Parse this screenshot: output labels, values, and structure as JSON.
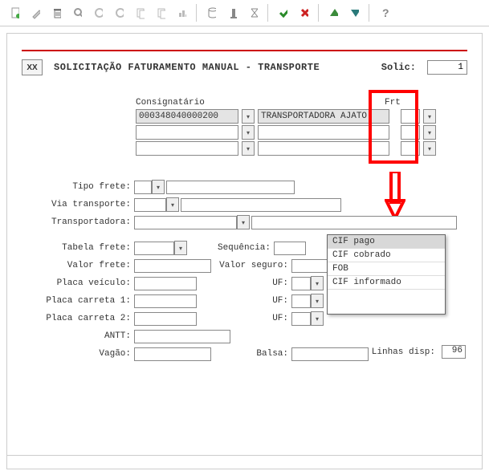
{
  "toolbar": {
    "icons": [
      "new-doc",
      "edit",
      "delete",
      "search",
      "refresh",
      "circle",
      "copy-left",
      "copy-right",
      "chart",
      "barrel",
      "info",
      "hourglass",
      "check",
      "cancel",
      "up",
      "down",
      "help"
    ]
  },
  "header": {
    "xx": "XX",
    "title": "SOLICITAÇÃO FATURAMENTO MANUAL - TRANSPORTE",
    "solic_label": "Solic:",
    "solic_value": "1"
  },
  "consignatario": {
    "header_c1": "Consignatário",
    "header_c2": "",
    "header_c3": "Frt",
    "rows": [
      {
        "code": "000348040000200",
        "name": "TRANSPORTADORA AJATO",
        "frt": ""
      },
      {
        "code": "",
        "name": "",
        "frt": ""
      },
      {
        "code": "",
        "name": "",
        "frt": ""
      }
    ]
  },
  "form": {
    "tipo_frete_label": "Tipo frete:",
    "via_transporte_label": "Via transporte:",
    "transportadora_label": "Transportadora:",
    "tabela_frete_label": "Tabela frete:",
    "sequencia_label": "Sequência:",
    "valor_frete_label": "Valor frete:",
    "valor_seguro_label": "Valor seguro:",
    "placa_veiculo_label": "Placa veículo:",
    "uf_label": "UF:",
    "placa_carreta1_label": "Placa carreta 1:",
    "placa_carreta2_label": "Placa carreta 2:",
    "antt_label": "ANTT:",
    "vagao_label": "Vagão:",
    "balsa_label": "Balsa:"
  },
  "dropdown": {
    "options": [
      "CIF pago",
      "CIF cobrado",
      "FOB",
      "CIF informado"
    ],
    "selected_index": 0
  },
  "footer": {
    "linhas_disp_label": "Linhas disp:",
    "linhas_disp_value": "96"
  }
}
